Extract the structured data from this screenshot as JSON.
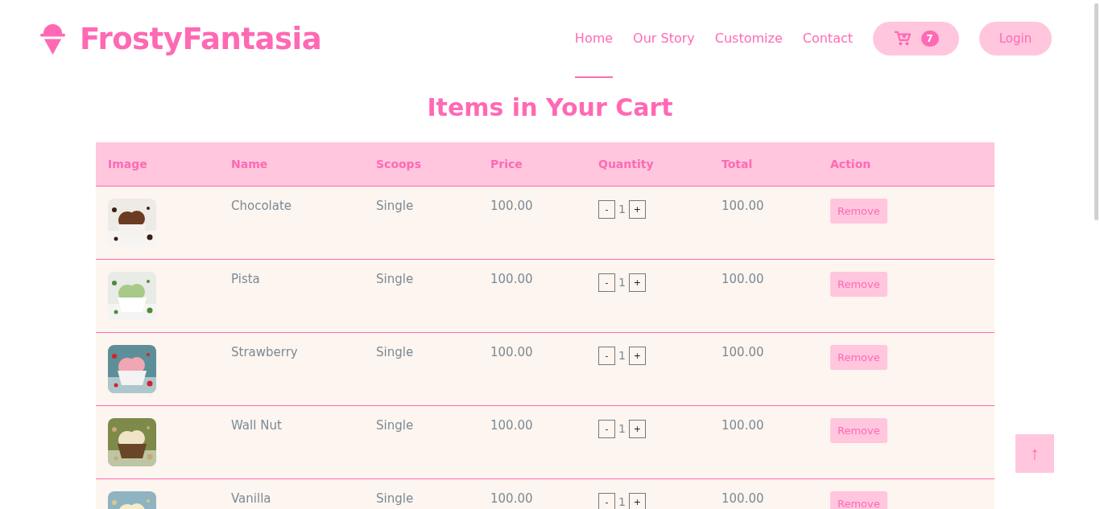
{
  "brand": {
    "name": "FrostyFantasia"
  },
  "nav": [
    {
      "label": "Home",
      "selected": true
    },
    {
      "label": "Our Story",
      "selected": false
    },
    {
      "label": "Customize",
      "selected": false
    },
    {
      "label": "Contact",
      "selected": false
    }
  ],
  "cart": {
    "count": "7"
  },
  "login": {
    "label": "Login"
  },
  "heading": "Items in Your Cart",
  "table": {
    "columns": [
      "Image",
      "Name",
      "Scoops",
      "Price",
      "Quantity",
      "Total",
      "Action"
    ],
    "rows": [
      {
        "name": "Chocolate",
        "scoops": "Single",
        "price": "100.00",
        "minus": "-",
        "quantity": "1",
        "plus": "+",
        "total": "100.00",
        "action": "Remove"
      },
      {
        "name": "Pista",
        "scoops": "Single",
        "price": "100.00",
        "minus": "-",
        "quantity": "1",
        "plus": "+",
        "total": "100.00",
        "action": "Remove"
      },
      {
        "name": "Strawberry",
        "scoops": "Single",
        "price": "100.00",
        "minus": "-",
        "quantity": "1",
        "plus": "+",
        "total": "100.00",
        "action": "Remove"
      },
      {
        "name": "Wall Nut",
        "scoops": "Single",
        "price": "100.00",
        "minus": "-",
        "quantity": "1",
        "plus": "+",
        "total": "100.00",
        "action": "Remove"
      },
      {
        "name": "Vanilla",
        "scoops": "Single",
        "price": "100.00",
        "minus": "-",
        "quantity": "1",
        "plus": "+",
        "total": "100.00",
        "action": "Remove"
      }
    ]
  },
  "back_to_top": {
    "label": "↑"
  }
}
